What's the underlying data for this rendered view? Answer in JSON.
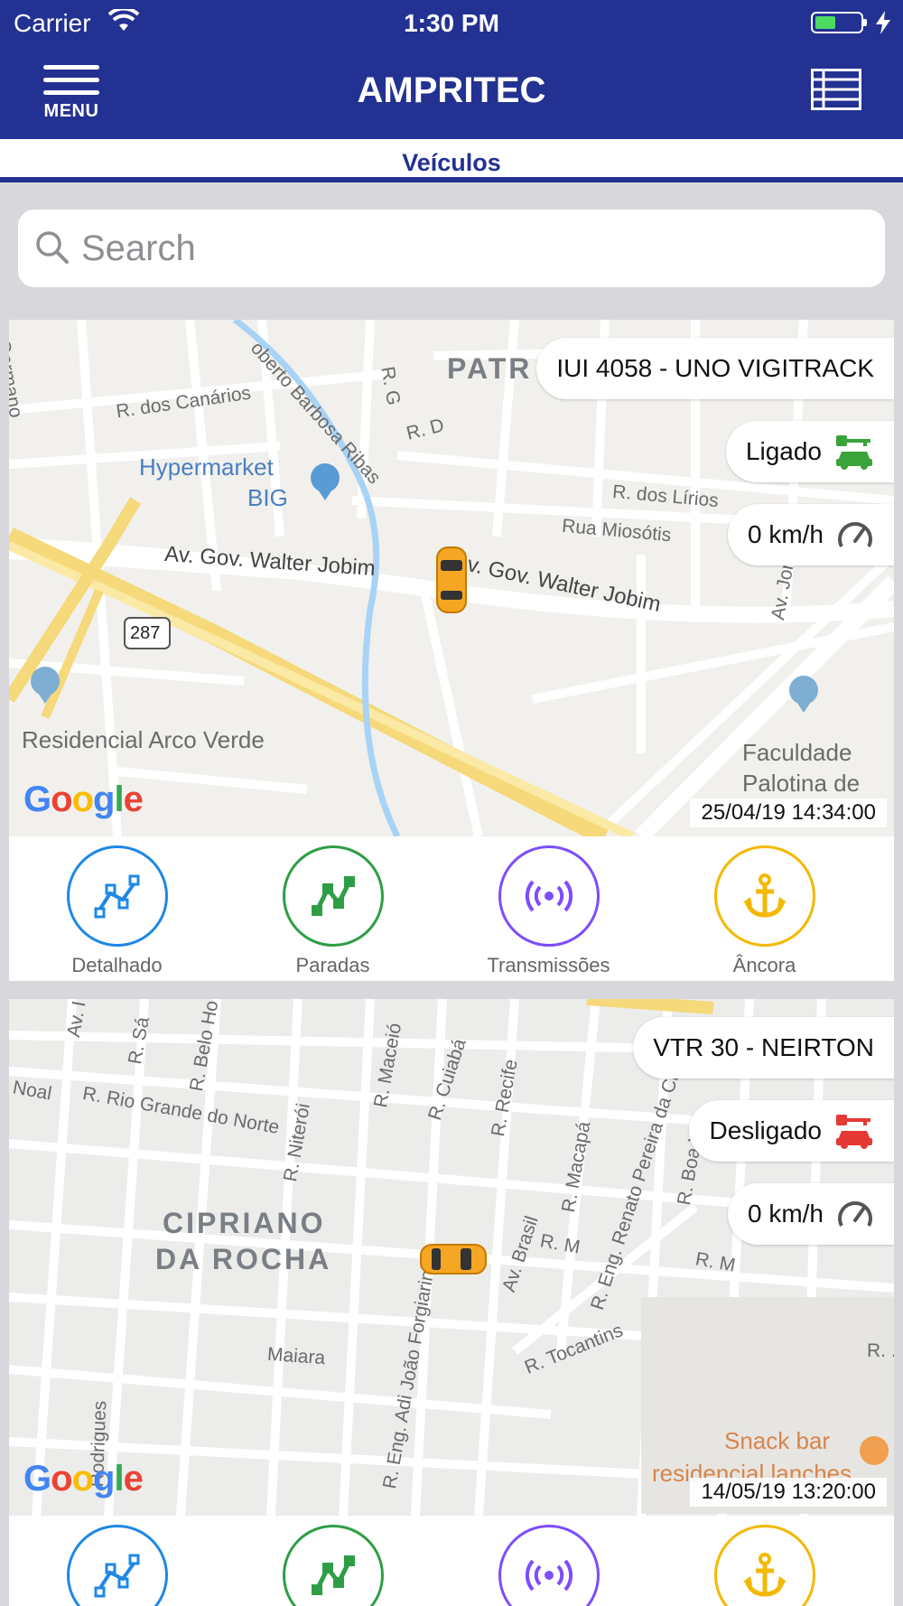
{
  "status_bar": {
    "carrier": "Carrier",
    "time": "1:30 PM"
  },
  "header": {
    "menu_label": "MENU",
    "title": "AMPRITEC"
  },
  "subheader": {
    "label": "Veículos"
  },
  "search": {
    "placeholder": "Search",
    "value": ""
  },
  "vehicles": [
    {
      "name": "IUI 4058 - UNO VIGITRACK",
      "ignition": "Ligado",
      "ignition_color": "#3aa33a",
      "speed": "0 km/h",
      "timestamp": "25/04/19 14:34:00",
      "map_labels": {
        "germano": "Germano",
        "roberto": "oberto Barbosa Ribas",
        "canarios": "R. dos Canários",
        "rg": "R. G",
        "rd": "R. D",
        "patr": "PATR",
        "hypermarket": "Hypermarket",
        "big": "BIG",
        "lirios": "R. dos Lírios",
        "miosotis": "Rua Miosótis",
        "walter1": "Av. Gov. Walter Jobim",
        "walter2": "Av. Gov. Walter Jobim",
        "route": "287",
        "residencial": "Residencial Arco Verde",
        "faculdade1": "Faculdade",
        "faculdade2": "Palotina de",
        "jorn": "Av. Jorn"
      }
    },
    {
      "name": "VTR 30 - NEIRTON",
      "ignition": "Desligado",
      "ignition_color": "#e53935",
      "speed": "0 km/h",
      "timestamp": "14/05/19 13:20:00",
      "map_labels": {
        "noal": "Noal",
        "rio_grande": "R. Rio Grande do Norte",
        "sa": "R. Sá",
        "belo": "R. Belo Ho",
        "maceio": "R. Maceió",
        "cuiaba": "R. Cuiabá",
        "recife": "R. Recife",
        "niteroi": "R. Niterói",
        "macapa": "R. Macapá",
        "renato": "R. Eng. Renato Pereira da Cr",
        "boa": "R. Boa V",
        "cipriano1": "CIPRIANO",
        "cipriano2": "DA ROCHA",
        "brasil": "Av. Brasil",
        "rm1": "R. M",
        "rm2": "R. M",
        "tocantins": "R. Tocantins",
        "maiara": "Maiara",
        "adi": "R. Eng. Adi João Forgiarini",
        "rodrigues": "Rodrigues",
        "snack1": "Snack bar",
        "snack2": "residencial lanches",
        "r_dots": "R. ."
      }
    }
  ],
  "actions": [
    {
      "label": "Detalhado",
      "icon": "route-detail-icon",
      "color": "#1e88e5"
    },
    {
      "label": "Paradas",
      "icon": "route-stops-icon",
      "color": "#2e9e44"
    },
    {
      "label": "Transmissões",
      "icon": "broadcast-icon",
      "color": "#7c4dff"
    },
    {
      "label": "Âncora",
      "icon": "anchor-icon",
      "color": "#f5b800"
    }
  ]
}
